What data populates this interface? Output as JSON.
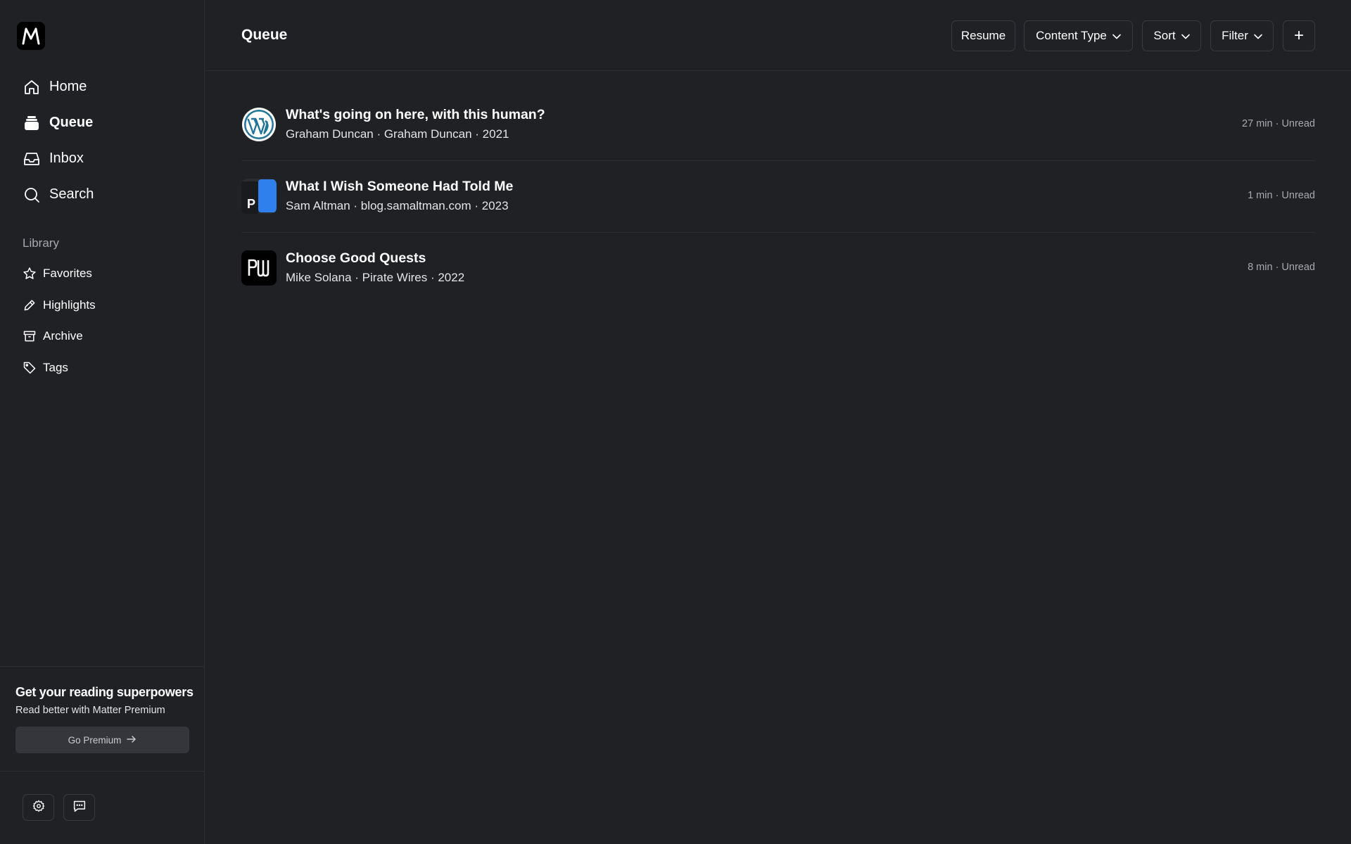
{
  "app": {
    "logo_icon": "matter-logo-icon"
  },
  "nav": [
    {
      "label": "Home",
      "icon": "home-icon"
    },
    {
      "label": "Queue",
      "icon": "queue-stack-icon",
      "active": true
    },
    {
      "label": "Inbox",
      "icon": "inbox-icon"
    },
    {
      "label": "Search",
      "icon": "search-icon"
    }
  ],
  "library": {
    "label": "Library",
    "items": [
      {
        "label": "Favorites",
        "icon": "star-icon"
      },
      {
        "label": "Highlights",
        "icon": "pencil-icon"
      },
      {
        "label": "Archive",
        "icon": "archive-icon"
      },
      {
        "label": "Tags",
        "icon": "tag-icon"
      }
    ]
  },
  "promo": {
    "title": "Get your reading superpowers",
    "subtitle": "Read better with Matter Premium",
    "button": "Go Premium"
  },
  "footer_buttons": [
    "settings-gear-icon",
    "feedback-chat-icon"
  ],
  "header": {
    "title": "Queue",
    "buttons": {
      "resume": "Resume",
      "content_type": "Content Type",
      "sort": "Sort",
      "filter": "Filter",
      "add": "+"
    }
  },
  "items": [
    {
      "title": "What's going on here, with this human?",
      "meta": "Graham Duncan · Graham Duncan · 2021",
      "right": "27 min · Unread",
      "icon": "wordpress-icon"
    },
    {
      "title": "What I Wish Someone Had Told Me",
      "meta": "Sam Altman · blog.samaltman.com · 2023",
      "right": "1 min · Unread",
      "icon": "posthaven-icon"
    },
    {
      "title": "Choose Good Quests",
      "meta": "Mike Solana · Pirate Wires · 2022",
      "right": "8 min · Unread",
      "icon": "pirate-wires-icon"
    }
  ],
  "colors": {
    "background": "#202125",
    "divider": "#2c2d31",
    "muted_text": "#a7a9ae",
    "wordpress_blue": "#21759b",
    "posthaven_blue": "#2f80ed"
  }
}
